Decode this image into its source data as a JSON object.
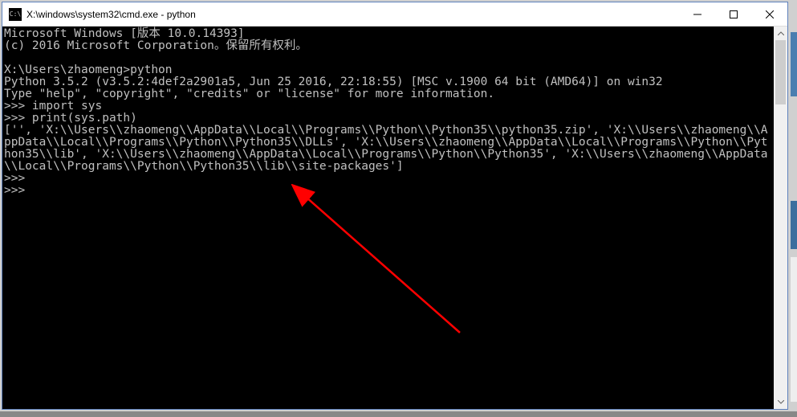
{
  "titlebar": {
    "icon_label": "C:\\",
    "title": "X:\\windows\\system32\\cmd.exe - python"
  },
  "terminal": {
    "lines": "Microsoft Windows [版本 10.0.14393]\n(c) 2016 Microsoft Corporation。保留所有权利。\n\nX:\\Users\\zhaomeng>python\nPython 3.5.2 (v3.5.2:4def2a2901a5, Jun 25 2016, 22:18:55) [MSC v.1900 64 bit (AMD64)] on win32\nType \"help\", \"copyright\", \"credits\" or \"license\" for more information.\n>>> import sys\n>>> print(sys.path)\n['', 'X:\\\\Users\\\\zhaomeng\\\\AppData\\\\Local\\\\Programs\\\\Python\\\\Python35\\\\python35.zip', 'X:\\\\Users\\\\zhaomeng\\\\AppData\\\\Local\\\\Programs\\\\Python\\\\Python35\\\\DLLs', 'X:\\\\Users\\\\zhaomeng\\\\AppData\\\\Local\\\\Programs\\\\Python\\\\Python35\\\\lib', 'X:\\\\Users\\\\zhaomeng\\\\AppData\\\\Local\\\\Programs\\\\Python\\\\Python35', 'X:\\\\Users\\\\zhaomeng\\\\AppData\\\\Local\\\\Programs\\\\Python\\\\Python35\\\\lib\\\\site-packages']\n>>>\n>>>"
  },
  "annotation": {
    "arrow_color": "#ff0000"
  }
}
